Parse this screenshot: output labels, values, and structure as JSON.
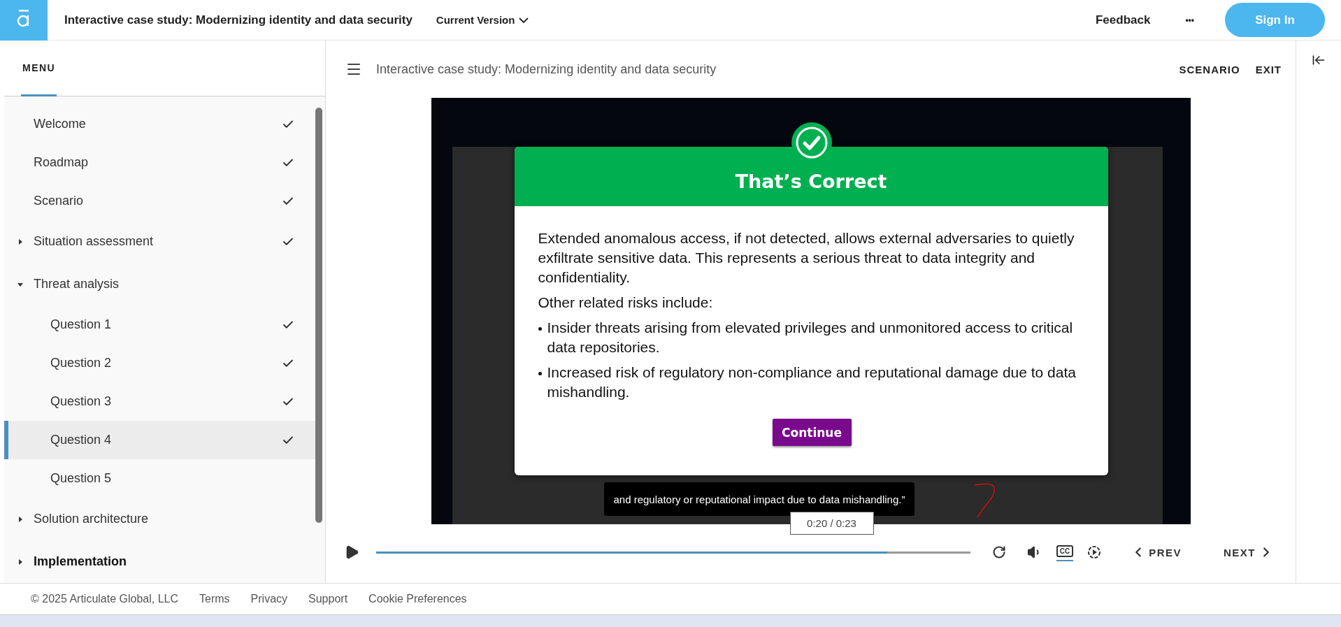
{
  "app_bar": {
    "title": "Interactive case study: Modernizing identity and data security",
    "version": "Current Version",
    "feedback": "Feedback",
    "more": "•••",
    "sign_in": "Sign In"
  },
  "sidebar": {
    "heading": "MENU",
    "items": [
      {
        "label": "Welcome",
        "kind": "page",
        "completed": true,
        "selected": false,
        "emphasized": false
      },
      {
        "label": "Roadmap",
        "kind": "page",
        "completed": true,
        "selected": false,
        "emphasized": false
      },
      {
        "label": "Scenario",
        "kind": "page",
        "completed": true,
        "selected": false,
        "emphasized": false
      },
      {
        "label": "Situation assessment",
        "kind": "section",
        "expanded": false,
        "completed": true,
        "selected": false,
        "emphasized": false
      },
      {
        "label": "Threat analysis",
        "kind": "section",
        "expanded": true,
        "completed": false,
        "selected": false,
        "emphasized": false,
        "children": [
          {
            "label": "Question 1",
            "kind": "page",
            "completed": true,
            "selected": false,
            "emphasized": false
          },
          {
            "label": "Question 2",
            "kind": "page",
            "completed": true,
            "selected": false,
            "emphasized": false
          },
          {
            "label": "Question 3",
            "kind": "page",
            "completed": true,
            "selected": false,
            "emphasized": false
          },
          {
            "label": "Question 4",
            "kind": "page",
            "completed": true,
            "selected": true,
            "emphasized": false
          },
          {
            "label": "Question 5",
            "kind": "page",
            "completed": false,
            "selected": false,
            "emphasized": false
          }
        ]
      },
      {
        "label": "Solution architecture",
        "kind": "section",
        "expanded": false,
        "completed": false,
        "selected": false,
        "emphasized": false
      },
      {
        "label": "Implementation",
        "kind": "section",
        "expanded": false,
        "completed": false,
        "selected": false,
        "emphasized": true
      }
    ]
  },
  "lesson": {
    "title": "Interactive case study: Modernizing identity and data security",
    "links": [
      "SCENARIO",
      "EXIT"
    ]
  },
  "dialog": {
    "title": "That’s Correct",
    "paragraphs": [
      "Extended anomalous access, if not detected, allows external adversaries to quietly exfiltrate sensitive data. This represents a serious threat to data integrity and confidentiality.",
      "Other related risks include:"
    ],
    "bullets": [
      "Insider threats arising from elevated privileges and unmonitored access to critical data repositories.",
      "Increased risk of regulatory non-compliance and reputational damage due to data mishandling."
    ],
    "button": "Continue"
  },
  "caption": "and regulatory or reputational impact due to data mishandling.”",
  "player": {
    "time": "0:20 / 0:23",
    "level": 0.86,
    "cc_label": "CC",
    "captions_on": true,
    "prev": "PREV",
    "next": "NEXT"
  },
  "footer": {
    "copyright": "© 2025 Articulate Global, LLC",
    "links": [
      "Terms",
      "Privacy",
      "Support",
      "Cookie Preferences"
    ]
  }
}
